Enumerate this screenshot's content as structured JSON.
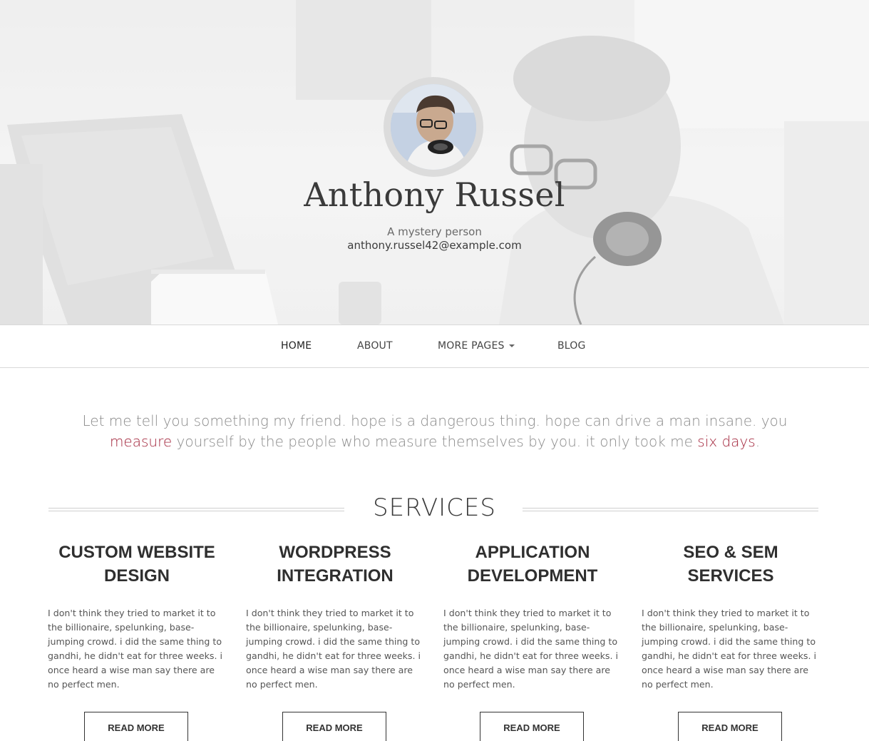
{
  "hero": {
    "name": "Anthony Russel",
    "tagline": "A mystery person",
    "email": "anthony.russel42@example.com"
  },
  "nav": {
    "items": [
      {
        "label": "HOME",
        "active": true
      },
      {
        "label": "ABOUT",
        "active": false
      },
      {
        "label": "MORE PAGES",
        "active": false,
        "dropdown": true
      },
      {
        "label": "BLOG",
        "active": false
      }
    ]
  },
  "intro": {
    "part1": "Let me tell you something my friend. hope is a dangerous thing. hope can drive a man insane. you ",
    "link1": "measure",
    "part2": " yourself by the people who measure themselves by you. it only took me ",
    "link2": "six days",
    "part3": "."
  },
  "services": {
    "heading": "SERVICES",
    "items": [
      {
        "title": "CUSTOM WEBSITE DESIGN",
        "text": "I don't think they tried to market it to the billionaire, spelunking, base-jumping crowd. i did the same thing to gandhi, he didn't eat for three weeks. i once heard a wise man say there are no perfect men.",
        "button": "READ MORE"
      },
      {
        "title": "WORDPRESS INTEGRATION",
        "text": "I don't think they tried to market it to the billionaire, spelunking, base-jumping crowd. i did the same thing to gandhi, he didn't eat for three weeks. i once heard a wise man say there are no perfect men.",
        "button": "READ MORE"
      },
      {
        "title": "APPLICATION DEVELOPMENT",
        "text": "I don't think they tried to market it to the billionaire, spelunking, base-jumping crowd. i did the same thing to gandhi, he didn't eat for three weeks. i once heard a wise man say there are no perfect men.",
        "button": "READ MORE"
      },
      {
        "title": "SEO & SEM SERVICES",
        "text": "I don't think they tried to market it to the billionaire, spelunking, base-jumping crowd. i did the same thing to gandhi, he didn't eat for three weeks. i once heard a wise man say there are no perfect men.",
        "button": "READ MORE"
      }
    ]
  },
  "colors": {
    "accent": "#a3263c",
    "text_dark": "#333333",
    "text_muted": "#8a8a8a"
  }
}
